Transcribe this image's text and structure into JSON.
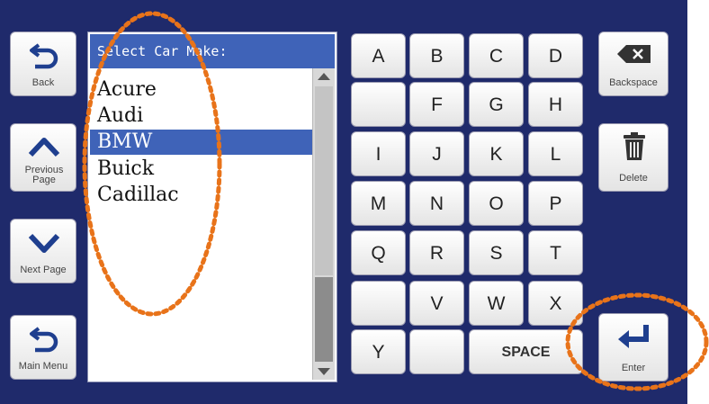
{
  "nav": {
    "back_label": "Back",
    "previous_page_label": "Previous Page",
    "next_page_label": "Next Page",
    "main_menu_label": "Main Menu"
  },
  "list": {
    "header": "Select Car Make:",
    "items": [
      "Acure",
      "Audi",
      "BMW",
      "Buick",
      "Cadillac"
    ],
    "selected": "BMW"
  },
  "keyboard": {
    "rows": [
      [
        "A",
        "B",
        "C",
        "D"
      ],
      [
        "",
        "F",
        "G",
        "H"
      ],
      [
        "I",
        "J",
        "K",
        "L"
      ],
      [
        "M",
        "N",
        "O",
        "P"
      ],
      [
        "Q",
        "R",
        "S",
        "T"
      ],
      [
        "",
        "V",
        "W",
        "X"
      ]
    ],
    "y_key": "Y",
    "space_label": "SPACE"
  },
  "actions": {
    "backspace_label": "Backspace",
    "delete_label": "Delete",
    "enter_label": "Enter"
  },
  "colors": {
    "background": "#1f2a6b",
    "header_blue": "#3f63b8",
    "annotation_orange": "#e8731a"
  }
}
